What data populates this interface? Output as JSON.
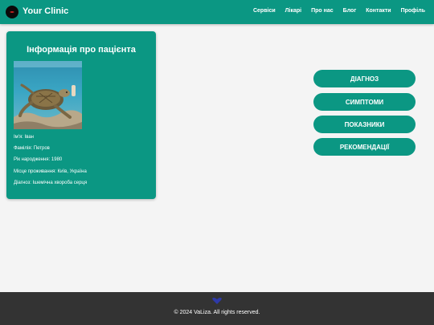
{
  "header": {
    "brand": "Your Clinic",
    "logo_icon": "clinic-logo-icon",
    "nav": [
      "Сервіси",
      "Лікарі",
      "Про нас",
      "Блог",
      "Контакти",
      "Профіль"
    ]
  },
  "patient_card": {
    "title": "Інформація про пацієнта",
    "photo_alt": "sea-turtle-photo",
    "fields": [
      {
        "label": "Ім'я:",
        "value": "Іван"
      },
      {
        "label": "Фамілія:",
        "value": "Петров"
      },
      {
        "label": "Рік народження:",
        "value": "1980"
      },
      {
        "label": "Місце проживання:",
        "value": "Київ, Україна"
      },
      {
        "label": "Діагноз:",
        "value": "Ішемічна хвороба серця"
      }
    ]
  },
  "actions": [
    "ДІАГНОЗ",
    "СИМПТОМИ",
    "ПОКАЗНИКИ",
    "РЕКОМЕНДАЦІЇ"
  ],
  "footer": {
    "text": "© 2024 VaLiza. All rights reserved.",
    "icon": "heart-icon"
  },
  "colors": {
    "primary": "#0b9783",
    "background": "#f4f4f4",
    "footer": "#333333"
  }
}
